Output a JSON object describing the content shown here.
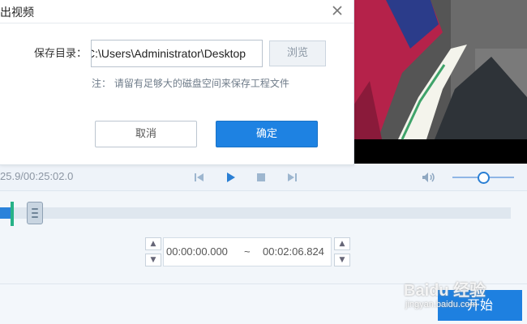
{
  "dialog": {
    "title": "输出视频",
    "save_dir_label": "保存目录：",
    "save_dir_value": "C:\\Users\\Administrator\\Desktop",
    "browse_label": "浏览",
    "note": "注：  请留有足够大的磁盘空间来保存工程文件",
    "cancel_label": "取消",
    "ok_label": "确定"
  },
  "player": {
    "time_readout": "25.9/00:25:02.0",
    "volume_level": 0.5
  },
  "editor": {
    "start_time": "00:00:00.000",
    "separator": "~",
    "end_time": "00:02:06.824",
    "playhead_fraction": 0.02
  },
  "footer": {
    "start_button_label": "开始",
    "watermark_text": "Baidu 经验",
    "watermark_url": "jingyan.baidu.com"
  },
  "colors": {
    "accent": "#1e80e0",
    "playhead": "#27b287",
    "timeline_track": "#dfe7ef"
  }
}
